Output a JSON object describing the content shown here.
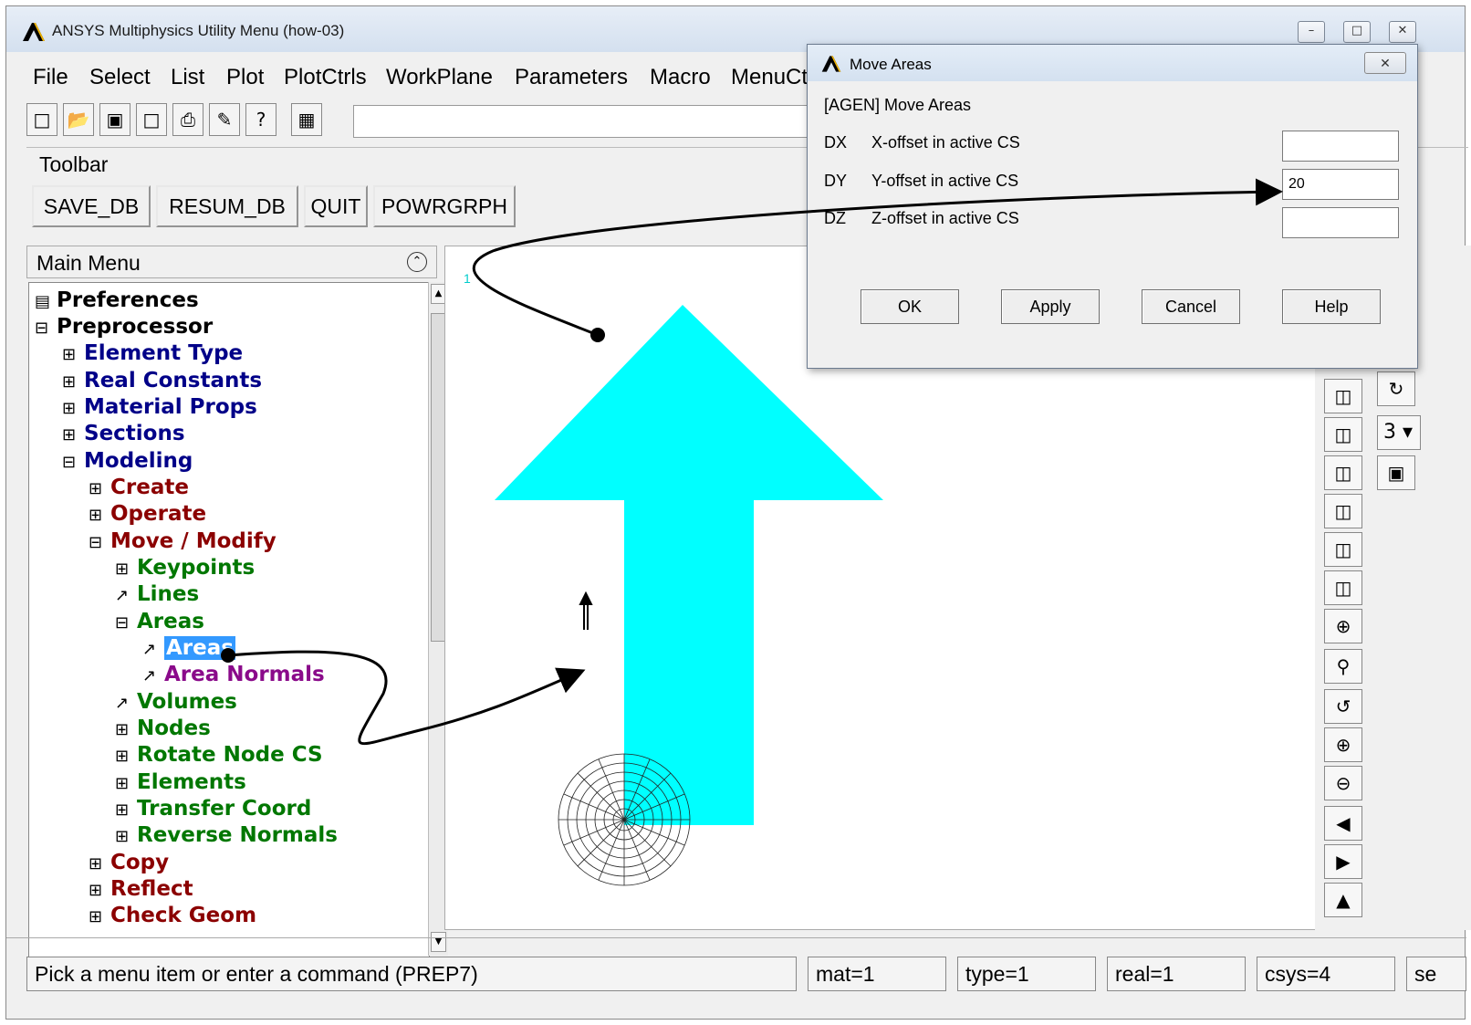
{
  "window": {
    "title": "ANSYS Multiphysics Utility Menu (how-03)",
    "controls": [
      "–",
      "□",
      "✕"
    ]
  },
  "menubar": {
    "items": [
      "File",
      "Select",
      "List",
      "Plot",
      "PlotCtrls",
      "WorkPlane",
      "Parameters",
      "Macro",
      "MenuCt"
    ]
  },
  "toolbar": {
    "label": "Toolbar",
    "buttons": [
      "SAVE_DB",
      "RESUM_DB",
      "QUIT",
      "POWRGRPH"
    ]
  },
  "main_menu": {
    "title": "Main Menu",
    "items": [
      {
        "label": "Preferences"
      },
      {
        "label": "Preprocessor"
      },
      {
        "label": "Element Type"
      },
      {
        "label": "Real Constants"
      },
      {
        "label": "Material Props"
      },
      {
        "label": "Sections"
      },
      {
        "label": "Modeling"
      },
      {
        "label": "Create"
      },
      {
        "label": "Operate"
      },
      {
        "label": "Move / Modify"
      },
      {
        "label": "Keypoints"
      },
      {
        "label": "Lines"
      },
      {
        "label": "Areas"
      },
      {
        "label": "Areas"
      },
      {
        "label": "Area Normals"
      },
      {
        "label": "Volumes"
      },
      {
        "label": "Nodes"
      },
      {
        "label": "Rotate Node CS"
      },
      {
        "label": "Elements"
      },
      {
        "label": "Transfer Coord"
      },
      {
        "label": "Reverse Normals"
      },
      {
        "label": "Copy"
      },
      {
        "label": "Reflect"
      },
      {
        "label": "Check Geom"
      }
    ]
  },
  "graphics": {
    "window_number": "1",
    "fill_color": "#00ffff"
  },
  "side_toolbar": {
    "dropdown_value": "3"
  },
  "status": {
    "prompt": "Pick a menu item or enter a command (PREP7)",
    "mat": "mat=1",
    "type": "type=1",
    "real": "real=1",
    "csys": "csys=4",
    "sec": "se"
  },
  "dialog": {
    "title": "Move Areas",
    "header": "[AGEN]  Move Areas",
    "fields": [
      {
        "code": "DX",
        "label": "X-offset in active CS",
        "value": ""
      },
      {
        "code": "DY",
        "label": "Y-offset in active CS",
        "value": "20"
      },
      {
        "code": "DZ",
        "label": "Z-offset in active CS",
        "value": ""
      }
    ],
    "buttons": [
      "OK",
      "Apply",
      "Cancel",
      "Help"
    ],
    "close": "✕"
  }
}
